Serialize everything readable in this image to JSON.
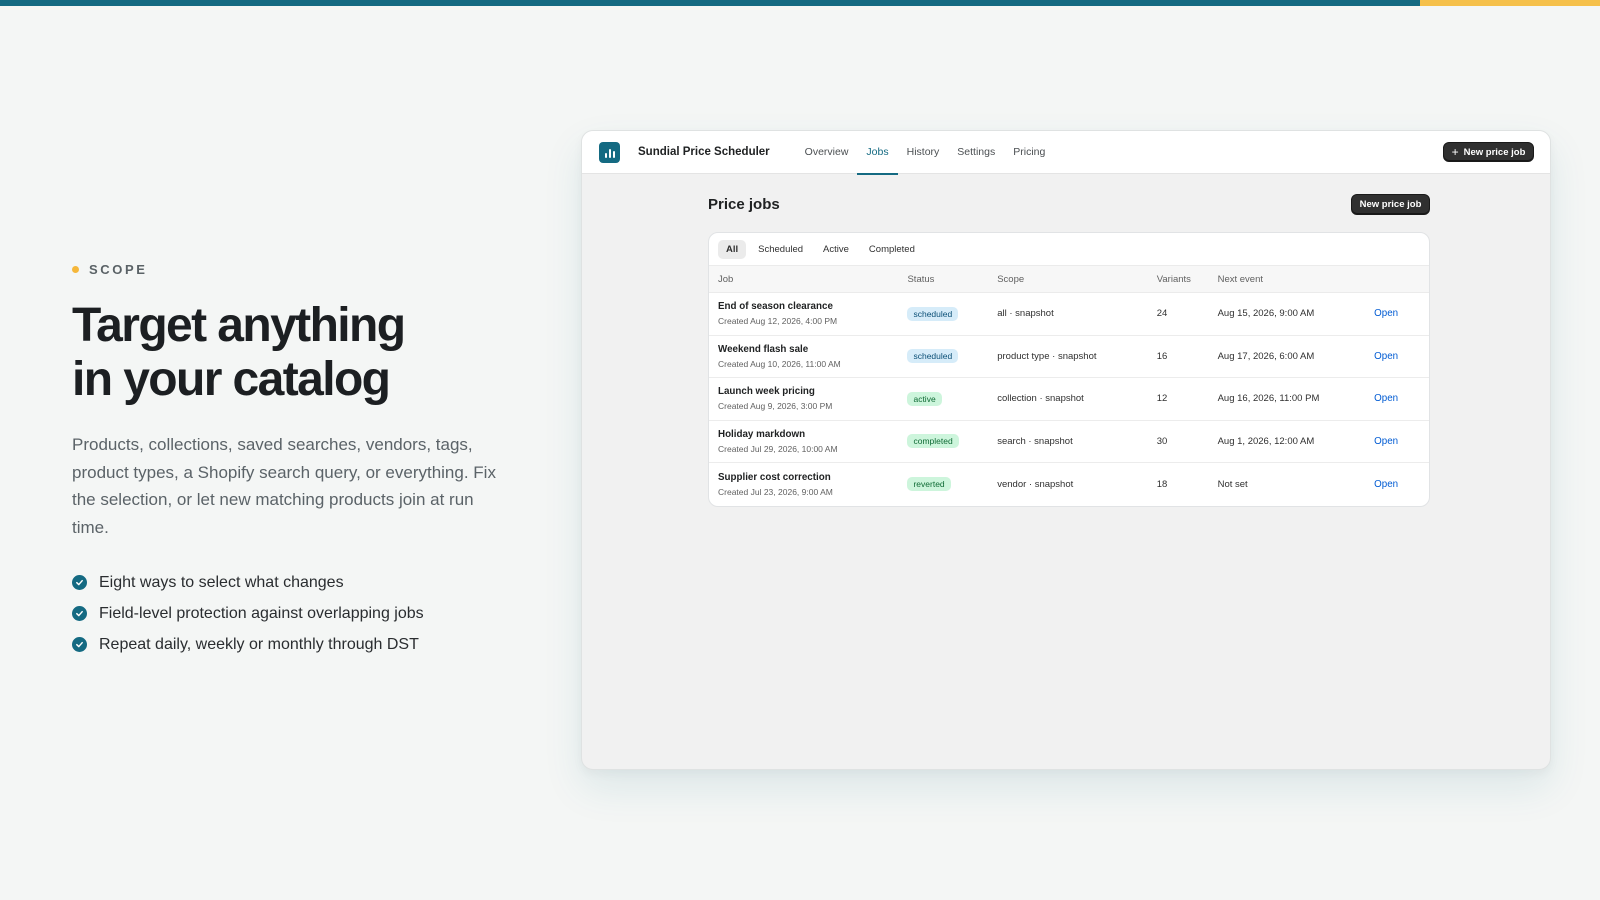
{
  "colors": {
    "brand": "#146a82",
    "accent": "#f5c04a",
    "link": "#005bd3"
  },
  "hero": {
    "eyebrow": "SCOPE",
    "headline_line1": "Target anything",
    "headline_line2": "in your catalog",
    "description": "Products, collections, saved searches, vendors, tags, product types, a Shopify search query, or everything. Fix the selection, or let new matching products join at run time.",
    "bullets": [
      "Eight ways to select what changes",
      "Field-level protection against overlapping jobs",
      "Repeat daily, weekly or monthly through DST"
    ]
  },
  "app": {
    "name": "Sundial Price Scheduler",
    "nav": [
      "Overview",
      "Jobs",
      "History",
      "Settings",
      "Pricing"
    ],
    "active_nav": "Jobs",
    "header_button": "New price job",
    "page_title": "Price jobs",
    "page_button": "New price job",
    "filters": [
      "All",
      "Scheduled",
      "Active",
      "Completed"
    ],
    "active_filter": "All",
    "columns": [
      "Job",
      "Status",
      "Scope",
      "Variants",
      "Next event",
      ""
    ],
    "rows": [
      {
        "job": "End of season clearance",
        "created": "Created Aug 12, 2026, 4:00 PM",
        "status": "scheduled",
        "scope": "all · snapshot",
        "variants": "24",
        "next": "Aug 15, 2026, 9:00 AM",
        "action": "Open"
      },
      {
        "job": "Weekend flash sale",
        "created": "Created Aug 10, 2026, 11:00 AM",
        "status": "scheduled",
        "scope": "product type · snapshot",
        "variants": "16",
        "next": "Aug 17, 2026, 6:00 AM",
        "action": "Open"
      },
      {
        "job": "Launch week pricing",
        "created": "Created Aug 9, 2026, 3:00 PM",
        "status": "active",
        "scope": "collection · snapshot",
        "variants": "12",
        "next": "Aug 16, 2026, 11:00 PM",
        "action": "Open"
      },
      {
        "job": "Holiday markdown",
        "created": "Created Jul 29, 2026, 10:00 AM",
        "status": "completed",
        "scope": "search · snapshot",
        "variants": "30",
        "next": "Aug 1, 2026, 12:00 AM",
        "action": "Open"
      },
      {
        "job": "Supplier cost correction",
        "created": "Created Jul 23, 2026, 9:00 AM",
        "status": "reverted",
        "scope": "vendor · snapshot",
        "variants": "18",
        "next": "Not set",
        "action": "Open"
      }
    ]
  }
}
